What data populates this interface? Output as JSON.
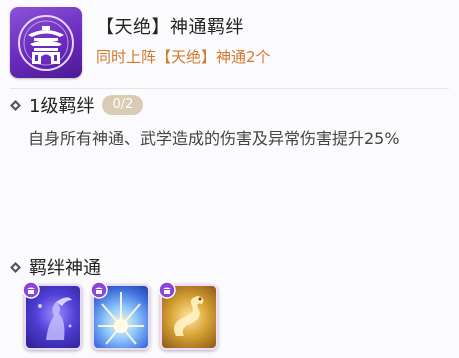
{
  "header": {
    "title": "【天绝】神通羁绊",
    "subtitle": "同时上阵【天绝】神通2个",
    "emblem_icon": "pavilion-icon"
  },
  "bond_level": {
    "title": "1级羁绊",
    "progress": "0/2",
    "description": "自身所有神通、武学造成的伤害及异常伤害提升25%"
  },
  "bond_skills": {
    "title": "羁绊神通",
    "cards": [
      {
        "icon": "spirit-figure-icon",
        "tag_icon": "pavilion-tag-icon"
      },
      {
        "icon": "light-burst-icon",
        "tag_icon": "pavilion-tag-icon"
      },
      {
        "icon": "golden-dragon-icon",
        "tag_icon": "pavilion-tag-icon"
      }
    ]
  },
  "colors": {
    "accent_orange": "#d27a2c",
    "emblem_purple": "#6a2bbd",
    "badge_tan": "#d9ccb4"
  }
}
